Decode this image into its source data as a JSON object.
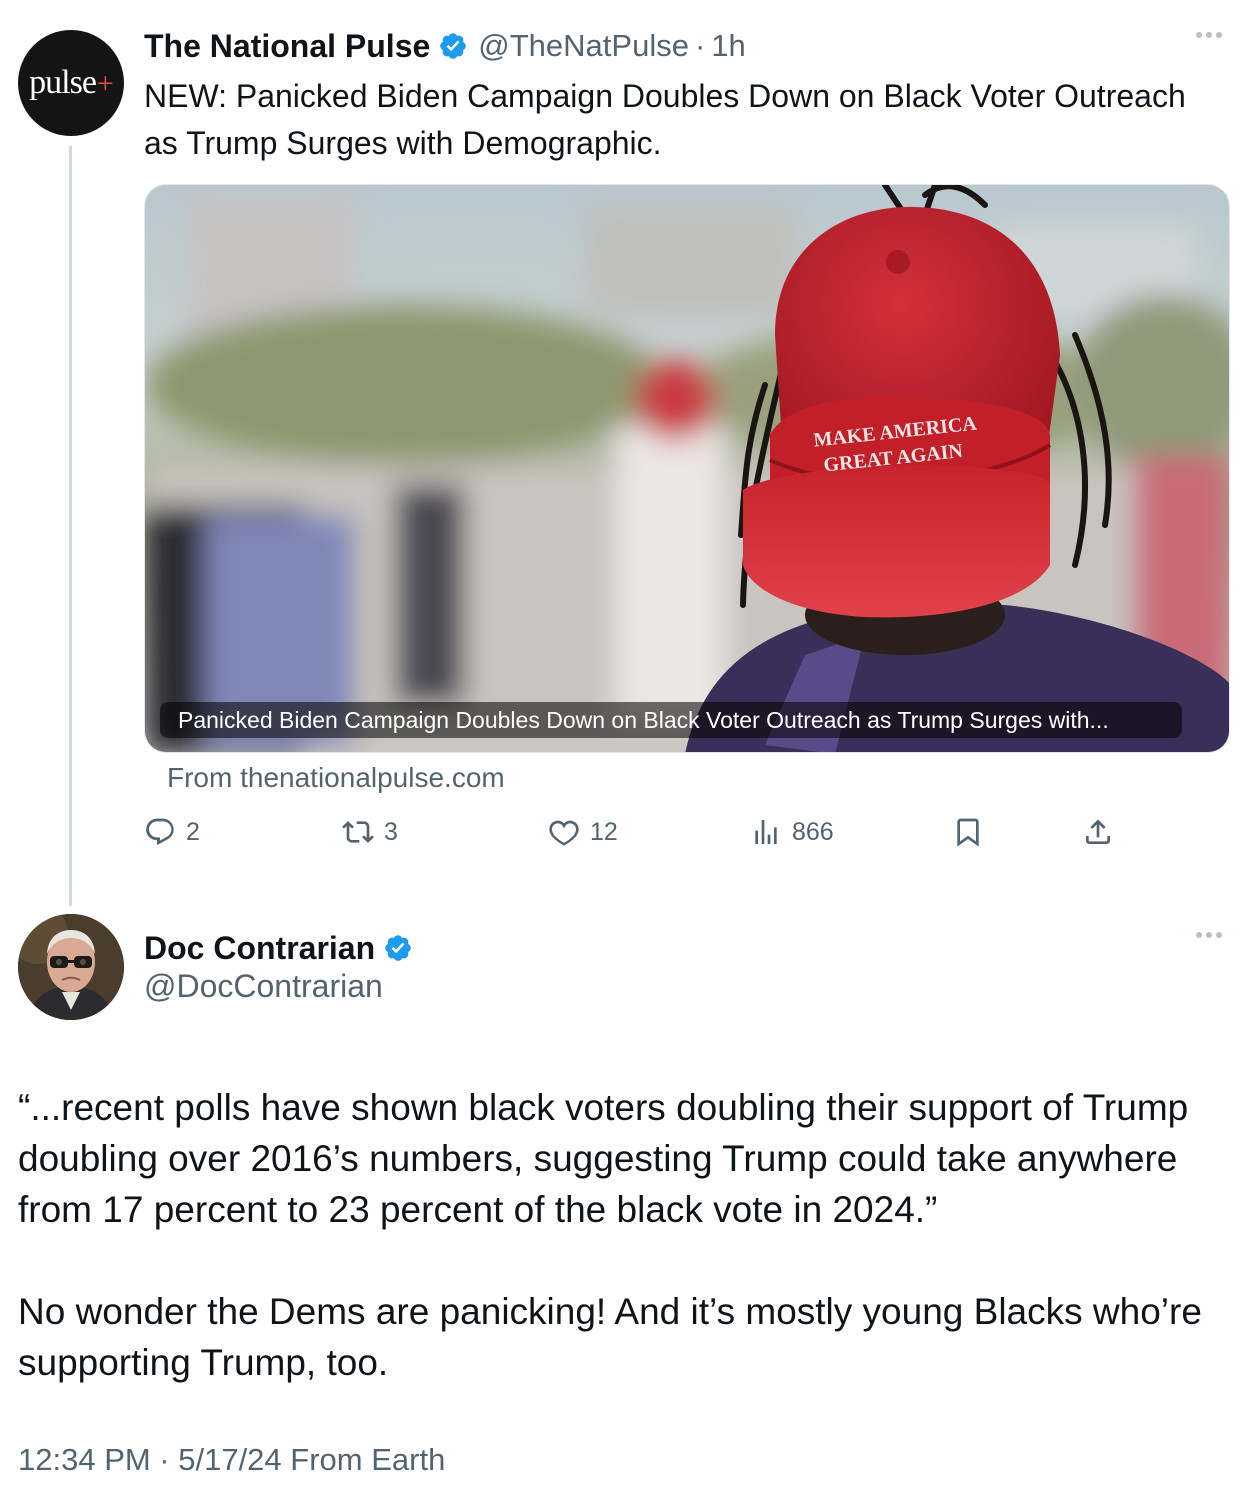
{
  "quoted_tweet": {
    "author": {
      "display_name": "The National Pulse",
      "verified": true,
      "avatar_logo": "pulse+",
      "handle": "@TheNatPulse",
      "separator": "·",
      "time_ago": "1h"
    },
    "text": "NEW: Panicked Biden Campaign Doubles Down on Black Voter Outreach as Trump Surges with Demographic.",
    "card": {
      "image_hat_text_line1": "MAKE AMERICA",
      "image_hat_text_line2": "GREAT AGAIN",
      "caption": "Panicked Biden Campaign Doubles Down on Black Voter Outreach as Trump Surges with...",
      "source": "From thenationalpulse.com"
    },
    "actions": {
      "replies": "2",
      "reposts": "3",
      "likes": "12",
      "views": "866"
    },
    "icons": [
      "reply-icon",
      "repost-icon",
      "like-icon",
      "views-icon",
      "bookmark-icon",
      "share-icon",
      "more-icon",
      "verified-badge-icon"
    ]
  },
  "main_tweet": {
    "author": {
      "display_name": "Doc Contrarian",
      "verified": true,
      "handle": "@DocContrarian"
    },
    "paragraphs": [
      "“...recent polls have shown black voters doubling their support of Trump doubling over 2016’s numbers, suggesting Trump could take anywhere from 17 percent to 23 percent of the black vote in 2024.”",
      "No wonder the Dems are panicking! And it’s mostly young Blacks who’re supporting Trump, too."
    ],
    "timestamp": "12:34 PM · 5/17/24 From Earth"
  },
  "colors": {
    "text_primary": "#0f1419",
    "text_secondary": "#536471",
    "verified_blue": "#1d9bf0",
    "thread_line": "#cfd9de",
    "hat_red": "#c5222d"
  }
}
